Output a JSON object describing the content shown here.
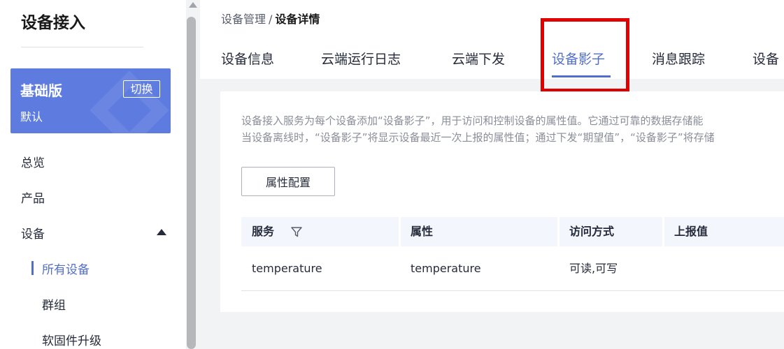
{
  "sidebar": {
    "title": "设备接入",
    "edition": {
      "name": "基础版",
      "sub": "默认",
      "switch_label": "切换"
    },
    "nav": {
      "overview": "总览",
      "products": "产品",
      "devices": "设备"
    },
    "subnav": {
      "all_devices": "所有设备",
      "groups": "群组",
      "firmware": "软固件升级"
    }
  },
  "header": {
    "breadcrumb": {
      "parent": "设备管理",
      "separator": "/",
      "current": "设备详情"
    },
    "tabs": [
      {
        "label": "设备信息"
      },
      {
        "label": "云端运行日志"
      },
      {
        "label": "云端下发"
      },
      {
        "label": "设备影子"
      },
      {
        "label": "消息跟踪"
      },
      {
        "label": "设备"
      }
    ],
    "active_tab": "设备影子"
  },
  "content": {
    "description_line1": "设备接入服务为每个设备添加“设备影子”，用于访问和控制设备的属性值。它通过可靠的数据存储能",
    "description_line2": "当设备离线时，“设备影子”将显示设备最近一次上报的属性值；通过下发“期望值”，“设备影子”将存储",
    "config_button": "属性配置",
    "table": {
      "columns": [
        "服务",
        "属性",
        "访问方式",
        "上报值"
      ],
      "rows": [
        {
          "service": "temperature",
          "property": "temperature",
          "access": "可读,可写",
          "reported": ""
        }
      ]
    }
  },
  "colors": {
    "accent": "#526ecc",
    "edition_card": "#5e7ce0",
    "highlight": "#e00000"
  }
}
